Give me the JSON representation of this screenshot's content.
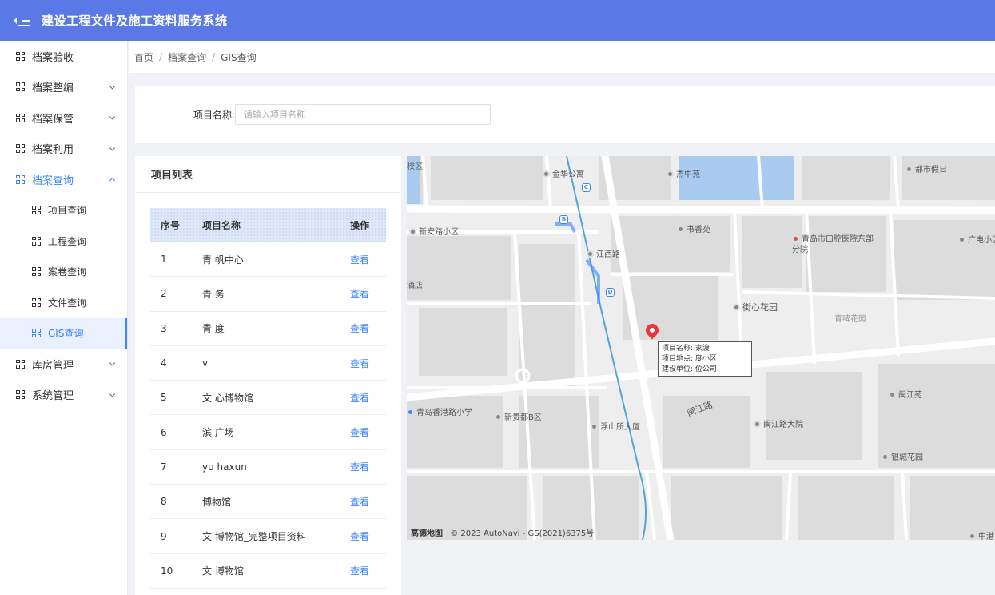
{
  "header": {
    "title": "建设工程文件及施工资料服务系统"
  },
  "sidebar": {
    "items": [
      {
        "label": "档案验收",
        "chevron": false
      },
      {
        "label": "档案整编",
        "chevron": true
      },
      {
        "label": "档案保管",
        "chevron": true
      },
      {
        "label": "档案利用",
        "chevron": true
      },
      {
        "label": "档案查询",
        "chevron": true,
        "expanded": true
      },
      {
        "label": "项目查询",
        "sub": true
      },
      {
        "label": "工程查询",
        "sub": true
      },
      {
        "label": "案卷查询",
        "sub": true
      },
      {
        "label": "文件查询",
        "sub": true
      },
      {
        "label": "GIS查询",
        "sub": true,
        "active": true
      },
      {
        "label": "库房管理",
        "chevron": true
      },
      {
        "label": "系统管理",
        "chevron": true
      }
    ]
  },
  "breadcrumb": {
    "home": "首页",
    "parent": "档案查询",
    "current": "GIS查询",
    "sep": "/"
  },
  "search": {
    "label": "项目名称:",
    "placeholder": "请输入项目名称"
  },
  "project_list": {
    "title": "项目列表",
    "columns": {
      "no": "序号",
      "name": "项目名称",
      "op": "操作"
    },
    "rows": [
      {
        "no": "1",
        "name": "青   帆中心",
        "op": "查看"
      },
      {
        "no": "2",
        "name": "青       务",
        "op": "查看"
      },
      {
        "no": "3",
        "name": "青     度",
        "op": "查看"
      },
      {
        "no": "4",
        "name": "v",
        "op": "查看"
      },
      {
        "no": "5",
        "name": "文     心博物馆",
        "op": "查看"
      },
      {
        "no": "6",
        "name": "滨     广场",
        "op": "查看"
      },
      {
        "no": "7",
        "name": "yu     haxun",
        "op": "查看"
      },
      {
        "no": "8",
        "name": "      博物馆",
        "op": "查看"
      },
      {
        "no": "9",
        "name": "文     博物馆_完整项目资料",
        "op": "查看"
      },
      {
        "no": "10",
        "name": "文     博物馆",
        "op": "查看"
      }
    ]
  },
  "map": {
    "labels": {
      "jinhua": "金华公寓",
      "jiezhong": "杰中苑",
      "dushi": "都市假日",
      "xinanlu": "新安路小区",
      "shuxiang": "书香苑",
      "hospital": "青岛市口腔医院东部分院",
      "guangdian": "广电小区",
      "jiangxilu": "江西路",
      "jiexin": "街心花园",
      "qingpi": "青啤花园",
      "xiaoqu": "校区",
      "jiudian": "酒店",
      "xianggang": "青岛香港路小学",
      "xinguidu": "新贵都B区",
      "fushan": "浮山所大厦",
      "minjianglu": "闽江路",
      "minjiangdayuan": "闽江路大院",
      "minjiangyuan": "闽江苑",
      "yincheng": "银城花园",
      "zhonggang": "中港"
    },
    "metro": {
      "c": "C",
      "b": "B",
      "d": "D"
    },
    "info": {
      "line1": "项目名称:      家渡",
      "line2": "项目地点:      度小区",
      "line3": "建设单位:      位公司"
    },
    "footer": {
      "logo": "高德地图",
      "copyright": "© 2023 AutoNavi - GS(2021)6375号"
    }
  }
}
